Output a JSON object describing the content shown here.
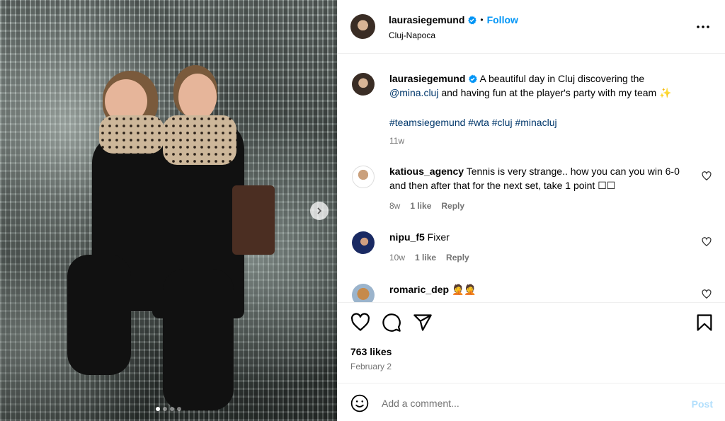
{
  "post": {
    "username": "laurasiegemund",
    "follow_label": "Follow",
    "separator": "•",
    "location": "Cluj-Napoca",
    "more_label": "•••"
  },
  "caption": {
    "username": "laurasiegemund",
    "text_part1": "A beautiful day in Cluj discovering the",
    "mention": "@mina.cluj",
    "text_part2": "and having fun at the player's party with my team ✨",
    "hashtags": [
      "#teamsiegemund",
      "#wta",
      "#cluj",
      "#minacluj"
    ],
    "time": "11w"
  },
  "comments": [
    {
      "username": "katious_agency",
      "text": "Tennis is very strange.. how you can you win 6-0 and then after that for the next set, take 1 point ☐☐",
      "time": "8w",
      "likes": "1 like",
      "reply": "Reply"
    },
    {
      "username": "nipu_f5",
      "text": "Fixer",
      "time": "10w",
      "likes": "1 like",
      "reply": "Reply"
    },
    {
      "username": "romaric_dep",
      "text": "🤦🤦",
      "time": "",
      "likes": "",
      "reply": ""
    }
  ],
  "engagement": {
    "likes": "763 likes",
    "date": "February 2"
  },
  "add_comment": {
    "placeholder": "Add a comment...",
    "post_label": "Post"
  },
  "carousel": {
    "total": 4,
    "active_index": 0
  },
  "colors": {
    "accent": "#0095f6",
    "link": "#00376b",
    "muted": "#737373",
    "post_disabled": "#b2dffc"
  },
  "icons": [
    "verified-badge-icon",
    "more-options-icon",
    "heart-icon",
    "comment-icon",
    "share-icon",
    "bookmark-icon",
    "emoji-icon",
    "chevron-right-icon"
  ]
}
